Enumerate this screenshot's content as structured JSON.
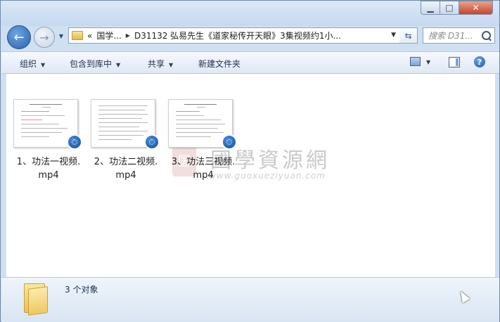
{
  "address": {
    "overflow": "«",
    "segments": [
      "国学...",
      "D31132 弘易先生《道家秘传开天眼》3集视频约1小..."
    ]
  },
  "search": {
    "placeholder": "搜索 D31..."
  },
  "toolbar": {
    "organize": "组织",
    "include_library": "包含到库中",
    "share": "共享",
    "new_folder": "新建文件夹"
  },
  "files": [
    {
      "name_line1": "1、功法一视频.",
      "name_line2": "mp4",
      "type": "video",
      "badge_icon": "media-player-icon"
    },
    {
      "name_line1": "2、功法二视频.",
      "name_line2": "mp4",
      "type": "video",
      "badge_icon": "media-player-icon"
    },
    {
      "name_line1": "3、功法三视频.",
      "name_line2": "mp4",
      "type": "video",
      "badge_icon": "media-player-icon"
    }
  ],
  "watermark": {
    "seal": "国",
    "title": "國學資源網",
    "url": "www.guoxueziyuan.com"
  },
  "status": {
    "count_text": "3 个对象"
  },
  "colors": {
    "frame": "#cfe0f2",
    "close_button": "#c8452a",
    "badge": "#0e4c9c",
    "folder": "#efc95e"
  }
}
